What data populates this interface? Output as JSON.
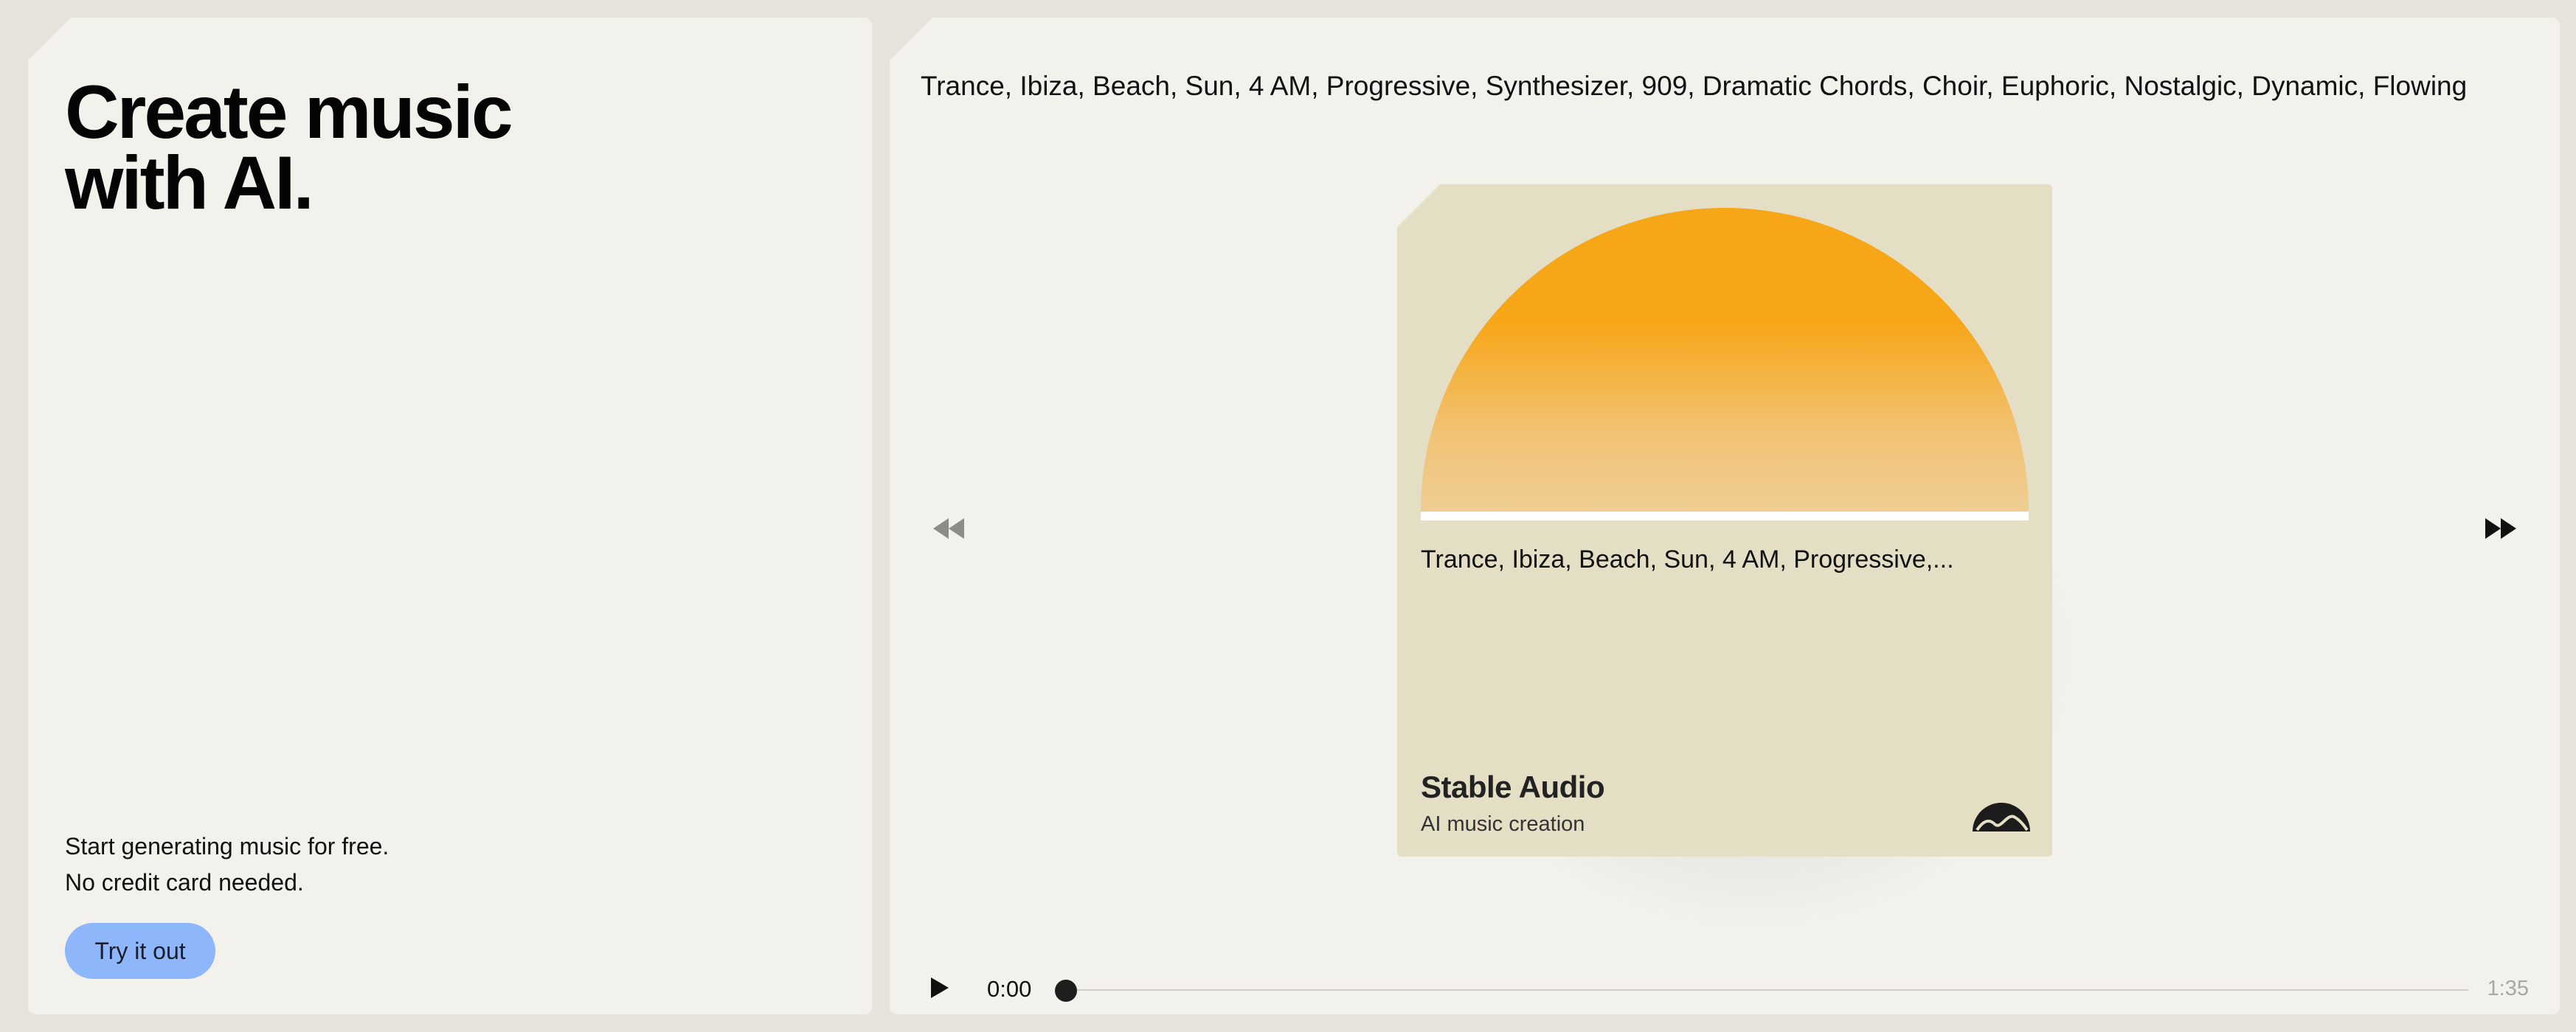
{
  "hero": {
    "headline_line1": "Create music",
    "headline_line2": "with AI.",
    "promo_line1": "Start generating music for free.",
    "promo_line2": "No credit card needed.",
    "cta_label": "Try it out"
  },
  "prompt": {
    "text": "Trance, Ibiza, Beach, Sun, 4 AM, Progressive, Synthesizer, 909, Dramatic Chords, Choir, Euphoric, Nostalgic, Dynamic, Flowing"
  },
  "card": {
    "caption": "Trance, Ibiza, Beach, Sun, 4 AM, Progressive,...",
    "brand_name": "Stable Audio",
    "brand_subtitle": "AI music creation",
    "logo_icon": "stable-audio-logo-icon"
  },
  "player": {
    "current_time": "0:00",
    "total_time": "1:35",
    "progress": 0,
    "play_icon": "play-icon",
    "prev_icon": "rewind-icon",
    "next_icon": "fast-forward-icon"
  },
  "colors": {
    "page_bg": "#e6e3db",
    "panel_bg": "#f3f1ec",
    "card_bg": "#e4dec5",
    "sun_top": "#f7a618",
    "sun_bottom": "#efcd92",
    "cta_bg": "#8db6fb"
  }
}
